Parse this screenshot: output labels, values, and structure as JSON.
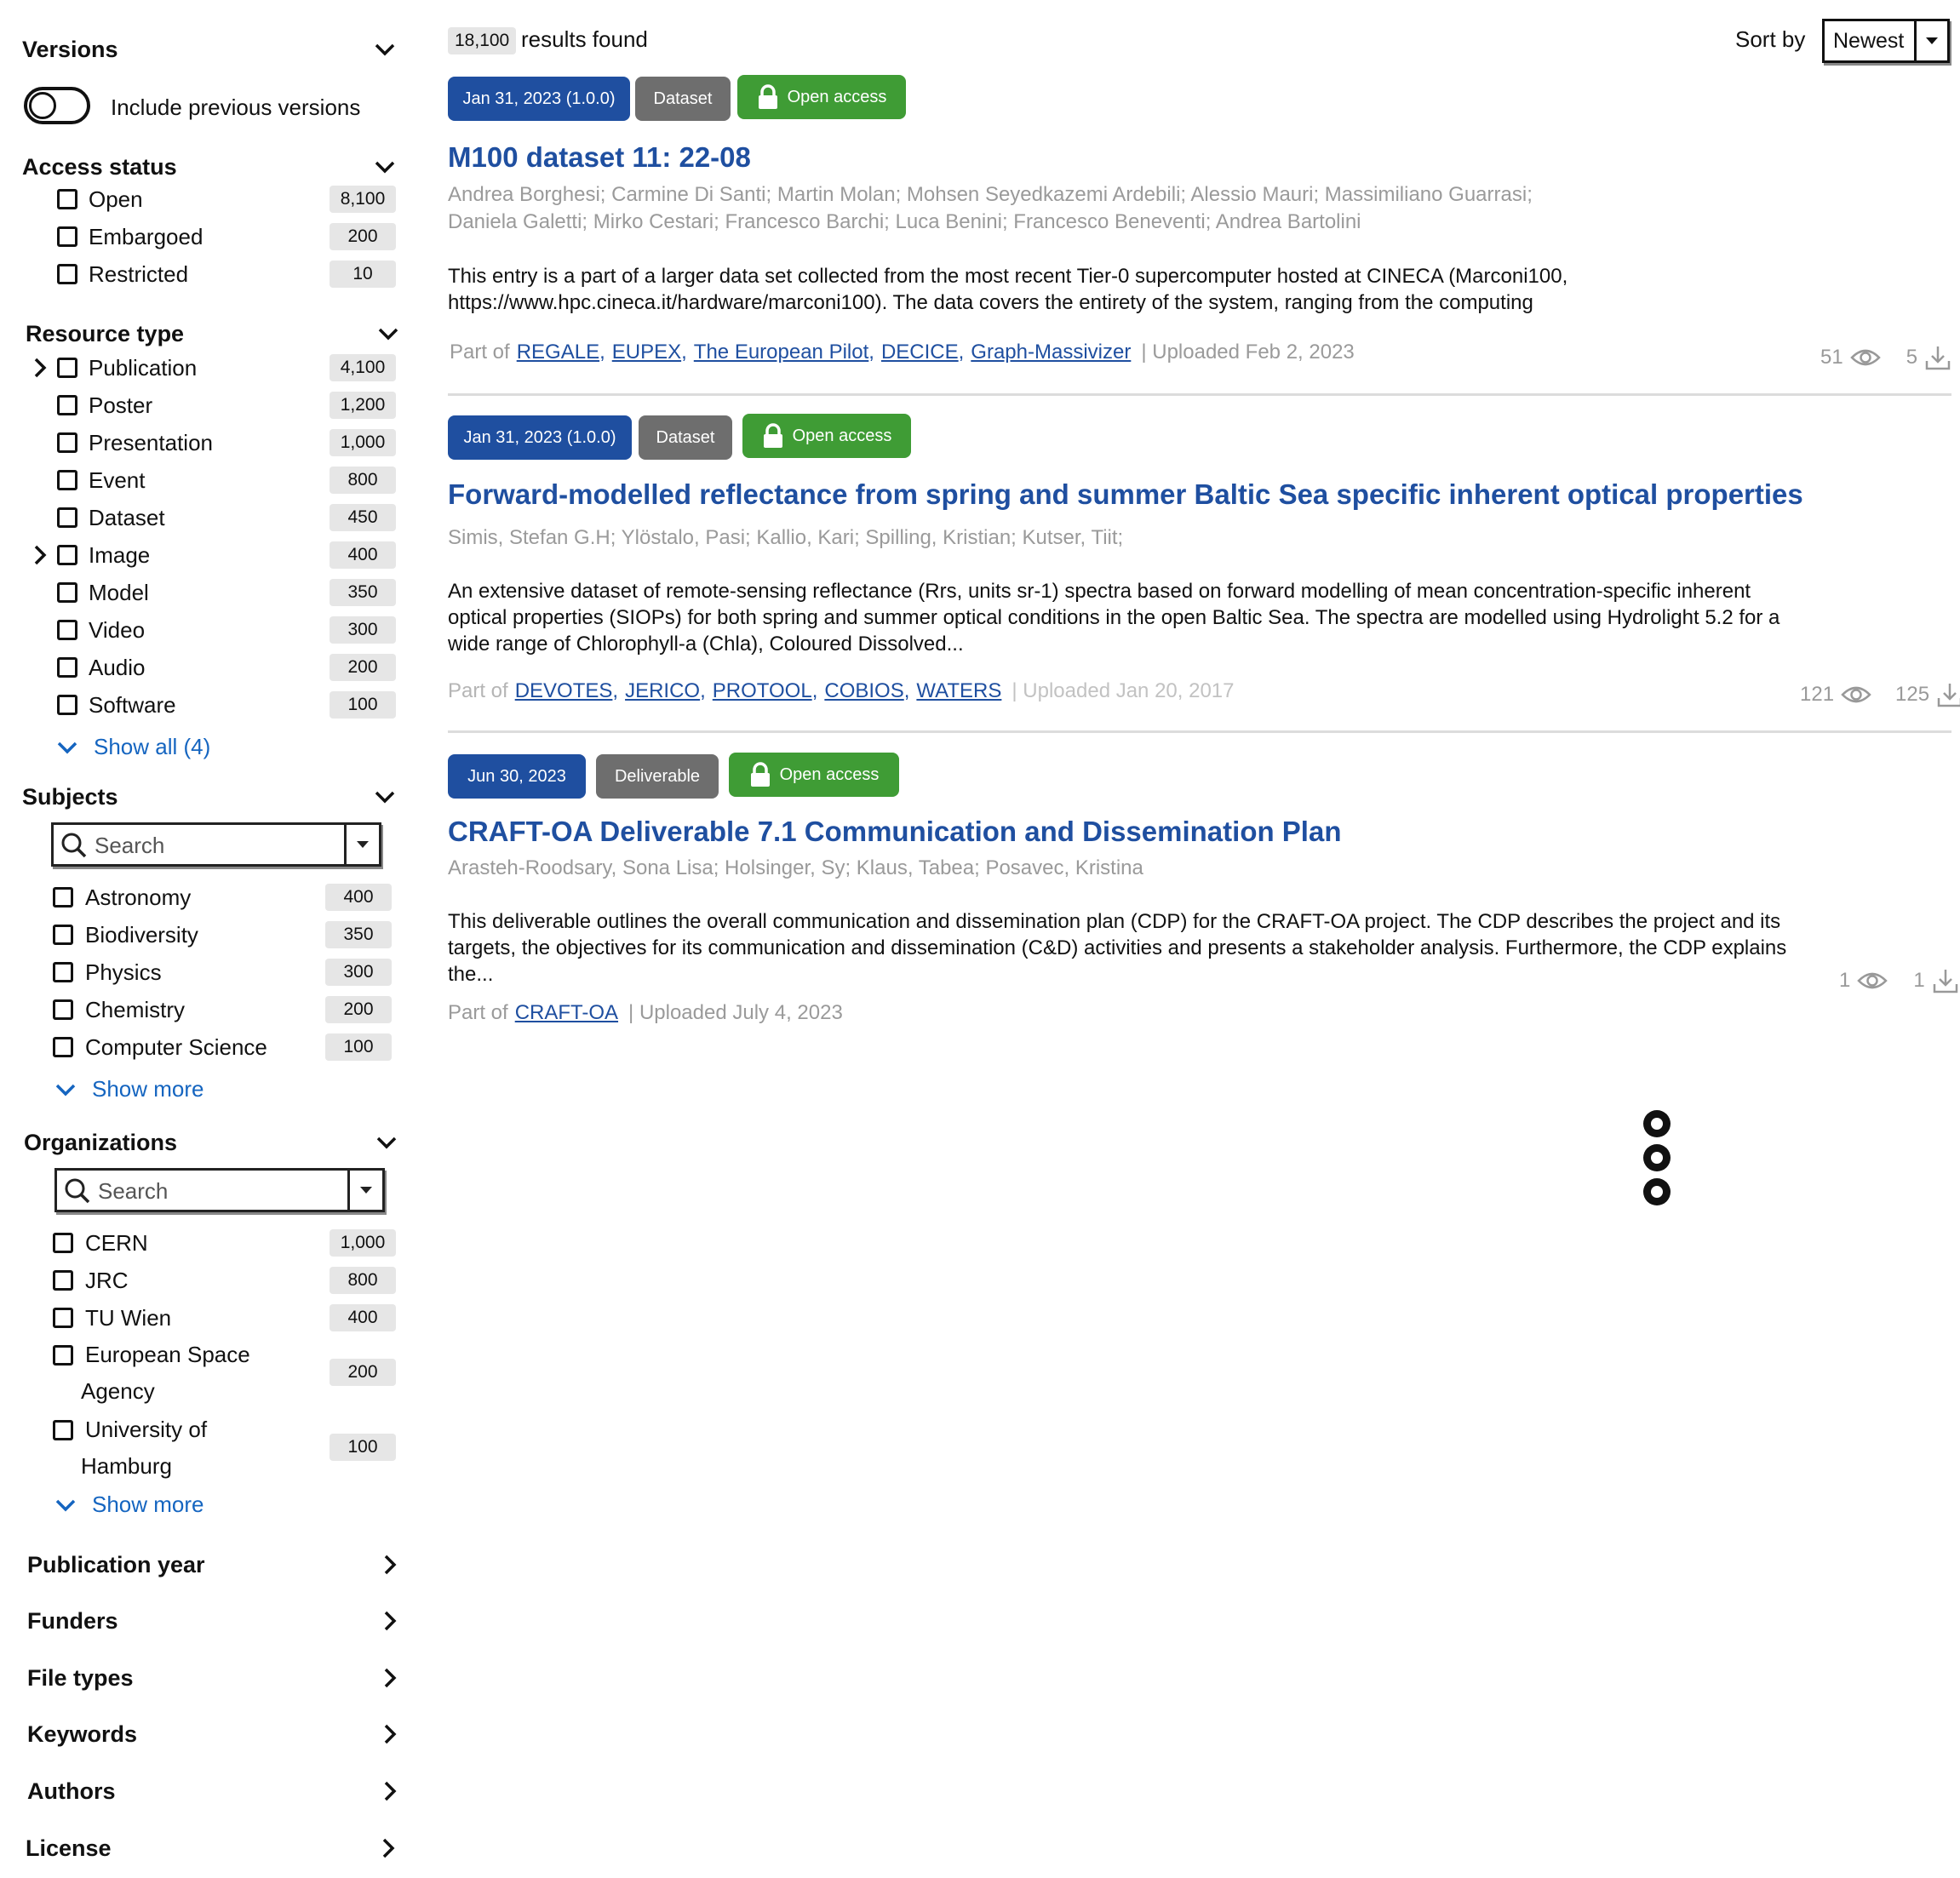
{
  "sidebar": {
    "versions": {
      "title": "Versions",
      "toggle_label": "Include previous versions",
      "toggle_on": false
    },
    "access_status": {
      "title": "Access status",
      "items": [
        {
          "label": "Open",
          "count": "8,100"
        },
        {
          "label": "Embargoed",
          "count": "200"
        },
        {
          "label": "Restricted",
          "count": "10"
        }
      ]
    },
    "resource_type": {
      "title": "Resource type",
      "items": [
        {
          "label": "Publication",
          "count": "4,100",
          "expandable": true
        },
        {
          "label": "Poster",
          "count": "1,200"
        },
        {
          "label": "Presentation",
          "count": "1,000"
        },
        {
          "label": "Event",
          "count": "800"
        },
        {
          "label": "Dataset",
          "count": "450"
        },
        {
          "label": "Image",
          "count": "400",
          "expandable": true
        },
        {
          "label": "Model",
          "count": "350"
        },
        {
          "label": "Video",
          "count": "300"
        },
        {
          "label": "Audio",
          "count": "200"
        },
        {
          "label": "Software",
          "count": "100"
        }
      ],
      "show_all": "Show all (4)"
    },
    "subjects": {
      "title": "Subjects",
      "search_placeholder": "Search",
      "items": [
        {
          "label": "Astronomy",
          "count": "400"
        },
        {
          "label": "Biodiversity",
          "count": "350"
        },
        {
          "label": "Physics",
          "count": "300"
        },
        {
          "label": "Chemistry",
          "count": "200"
        },
        {
          "label": "Computer Science",
          "count": "100"
        }
      ],
      "show_more": "Show more"
    },
    "organizations": {
      "title": "Organizations",
      "search_placeholder": "Search",
      "items": [
        {
          "label": "CERN",
          "count": "1,000"
        },
        {
          "label": "JRC",
          "count": "800"
        },
        {
          "label": "TU Wien",
          "count": "400"
        },
        {
          "label_line1": "European Space",
          "label_line2": "Agency",
          "count": "200"
        },
        {
          "label_line1": "University of",
          "label_line2": "Hamburg",
          "count": "100"
        }
      ],
      "show_more": "Show more"
    },
    "collapsed_sections": [
      "Publication year",
      "Funders",
      "File types",
      "Keywords",
      "Authors",
      "License"
    ]
  },
  "main": {
    "results_count": "18,100",
    "results_label": "results found",
    "sort_label": "Sort by",
    "sort_value": "Newest",
    "results": [
      {
        "date": "Jan 31, 2023 (1.0.0)",
        "type": "Dataset",
        "access": "Open access",
        "title": "M100 dataset 11: 22-08",
        "authors_line1": "Andrea Borghesi; Carmine Di Santi; Martin Molan;   Mohsen Seyedkazemi Ardebili; Alessio Mauri; Massimiliano Guarrasi;",
        "authors_line2": "Daniela Galetti; Mirko Cestari; Francesco Barchi; Luca Benini; Francesco Beneventi;   Andrea Bartolini",
        "desc_line1": "This entry is a part of a larger data set collected from the most recent Tier-0 supercomputer hosted at CINECA (Marconi100,",
        "desc_line2": "https://www.hpc.cineca.it/hardware/marconi100). The data covers the entirety of the system, ranging from the computing",
        "desc_line3": "",
        "part_of_label": "Part of",
        "communities": [
          "REGALE",
          "EUPEX",
          "The European Pilot",
          "DECICE",
          "Graph-Massivizer"
        ],
        "uploaded": "| Uploaded Feb 2, 2023",
        "views": "51",
        "downloads": "5"
      },
      {
        "date": "Jan 31, 2023 (1.0.0)",
        "type": "Dataset",
        "access": "Open access",
        "title": "Forward-modelled reflectance from spring and summer Baltic Sea specific inherent optical properties",
        "authors_line1": "Simis, Stefan G.H; Ylöstalo, Pasi; Kallio, Kari; Spilling, Kristian; Kutser, Tiit;",
        "authors_line2": "",
        "desc_line1": "An extensive dataset of remote-sensing reflectance (Rrs, units sr-1) spectra based on forward modelling of mean concentration-specific inherent",
        "desc_line2": "optical properties (SIOPs) for both spring and summer optical conditions in the open Baltic Sea. The spectra are modelled using Hydrolight 5.2 for a",
        "desc_line3": "wide range of Chlorophyll-a (Chla), Coloured Dissolved...",
        "part_of_label": "Part of",
        "communities": [
          "DEVOTES",
          "JERICO",
          "PROTOOL",
          "COBIOS",
          "WATERS"
        ],
        "uploaded": "| Uploaded Jan 20, 2017",
        "views": "121",
        "downloads": "125"
      },
      {
        "date": "Jun 30, 2023",
        "type": "Deliverable",
        "access": "Open access",
        "title": "CRAFT-OA Deliverable 7.1 Communication and Dissemination Plan",
        "authors_line1": "Arasteh-Roodsary, Sona Lisa; Holsinger, Sy;   Klaus, Tabea;   Posavec, Kristina",
        "authors_line2": "",
        "desc_line1": "This deliverable outlines the overall communication and dissemination plan (CDP) for the CRAFT-OA project. The CDP describes the project and its",
        "desc_line2": "targets, the objectives for its communication and dissemination (C&D) activities and presents a stakeholder analysis. Furthermore, the CDP explains",
        "desc_line3": "the...",
        "part_of_label": "Part of",
        "communities": [
          "CRAFT-OA"
        ],
        "uploaded": "| Uploaded July 4, 2023",
        "views": "1",
        "downloads": "1"
      }
    ],
    "loading_indicator": "loading-dots"
  }
}
